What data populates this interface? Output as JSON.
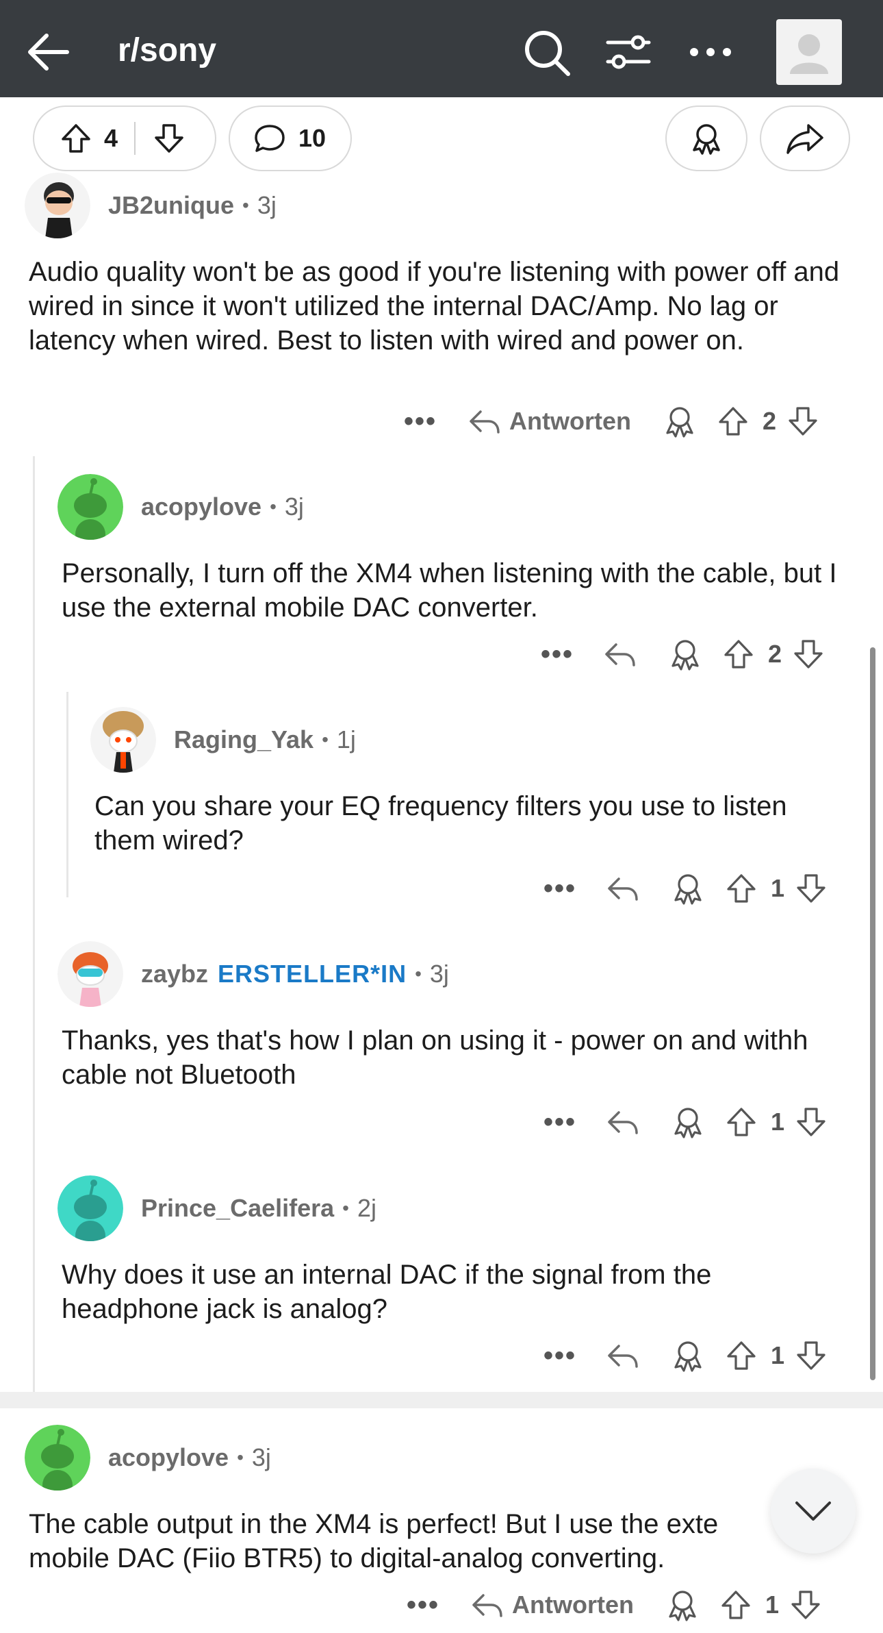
{
  "header": {
    "title": "r/sony",
    "icons": [
      "back-arrow-icon",
      "search-icon",
      "filter-icon",
      "more-icon",
      "user-avatar-icon"
    ],
    "bg_color": "#383c40"
  },
  "post_actions": {
    "upvotes": "4",
    "comments": "10"
  },
  "comments": [
    {
      "author": "JB2unique",
      "age": "3j",
      "dot": "•",
      "text": "Audio quality won't be as good if you're listening with power off and wired in since it won't utilized the internal DAC/Amp. No lag or latency when wired. Best to listen with wired and power on.",
      "reply_label": "Antworten",
      "votes": "2",
      "more": "•••"
    },
    {
      "author": "acopylove",
      "age": "3j",
      "dot": "•",
      "text": "Personally, I turn off the XM4 when listening with the cable, but I use the external mobile DAC converter.",
      "votes": "2",
      "more": "•••"
    },
    {
      "author": "Raging_Yak",
      "age": "1j",
      "dot": "•",
      "text": "Can you share your EQ frequency filters you use to listen them wired?",
      "votes": "1",
      "more": "•••"
    },
    {
      "author": "zaybz",
      "flair": "ERSTELLER*IN",
      "age": "3j",
      "dot": "•",
      "text": "Thanks, yes that's how I plan on using it - power on and withh cable not Bluetooth",
      "votes": "1",
      "more": "•••"
    },
    {
      "author": "Prince_Caelifera",
      "age": "2j",
      "dot": "•",
      "text": "Why does it use an internal DAC if the signal from the headphone jack is analog?",
      "votes": "1",
      "more": "•••"
    },
    {
      "author": "acopylove",
      "age": "3j",
      "dot": "•",
      "text": "The cable output in the XM4 is perfect! But I use the exte mobile DAC (Fiio BTR5) to digital-analog converting.",
      "reply_label": "Antworten",
      "votes": "1",
      "more": "•••"
    }
  ],
  "colors": {
    "flair": "#1a7ac7",
    "avatar_green": "#5fd35a",
    "avatar_teal": "#3fd8c6"
  }
}
